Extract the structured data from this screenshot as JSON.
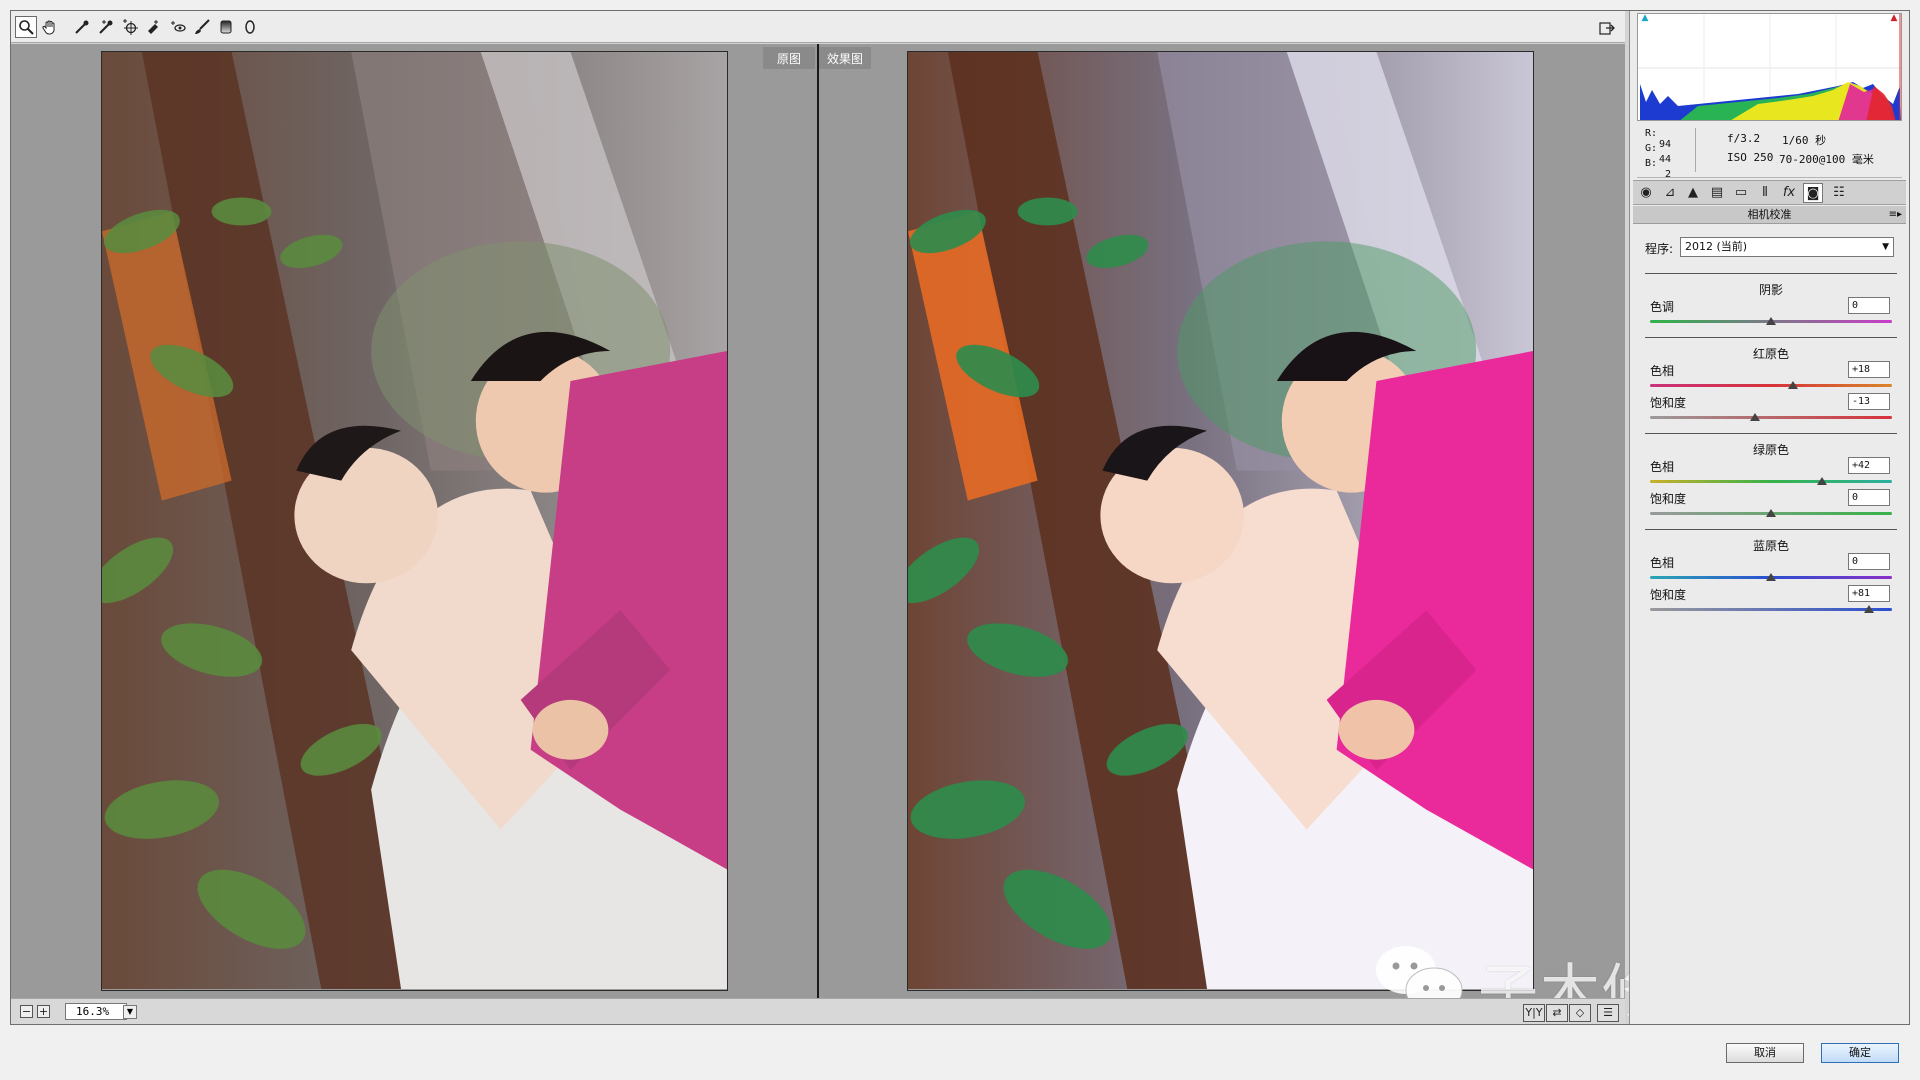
{
  "toolbar": {
    "tools": [
      "zoom-icon",
      "hand-icon",
      "white-balance-icon",
      "color-sampler-icon",
      "target-adjust-icon",
      "crop-icon",
      "straighten-icon",
      "spot-removal-icon",
      "red-eye-icon",
      "adjustment-brush-icon",
      "graduated-filter-icon",
      "radial-filter-icon"
    ],
    "export_icon": "open-preferences-icon"
  },
  "preview": {
    "before_label": "原图",
    "after_label": "效果图",
    "zoom_value": "16.3%"
  },
  "watermark": {
    "text": "子木修图培训"
  },
  "readout": {
    "r_label": "R:",
    "r_value": "94",
    "g_label": "G:",
    "g_value": "44",
    "b_label": "B:",
    "b_value": "2",
    "aperture": "f/3.2",
    "shutter": "1/60 秒",
    "iso": "ISO 250",
    "lens": "70-200@100 毫米"
  },
  "panel": {
    "section_title": "相机校准",
    "process_label": "程序:",
    "process_value": "2012 (当前)",
    "groups": [
      {
        "title": "阴影",
        "sliders": [
          {
            "label": "色调",
            "value": "0",
            "position": 0.5
          }
        ]
      },
      {
        "title": "红原色",
        "sliders": [
          {
            "label": "色相",
            "value": "+18",
            "position": 0.59
          },
          {
            "label": "饱和度",
            "value": "-13",
            "position": 0.435
          }
        ]
      },
      {
        "title": "绿原色",
        "sliders": [
          {
            "label": "色相",
            "value": "+42",
            "position": 0.71
          },
          {
            "label": "饱和度",
            "value": "0",
            "position": 0.5
          }
        ]
      },
      {
        "title": "蓝原色",
        "sliders": [
          {
            "label": "色相",
            "value": "0",
            "position": 0.5
          },
          {
            "label": "饱和度",
            "value": "+81",
            "position": 0.905
          }
        ]
      }
    ]
  },
  "buttons": {
    "cancel": "取消",
    "ok": "确定"
  }
}
